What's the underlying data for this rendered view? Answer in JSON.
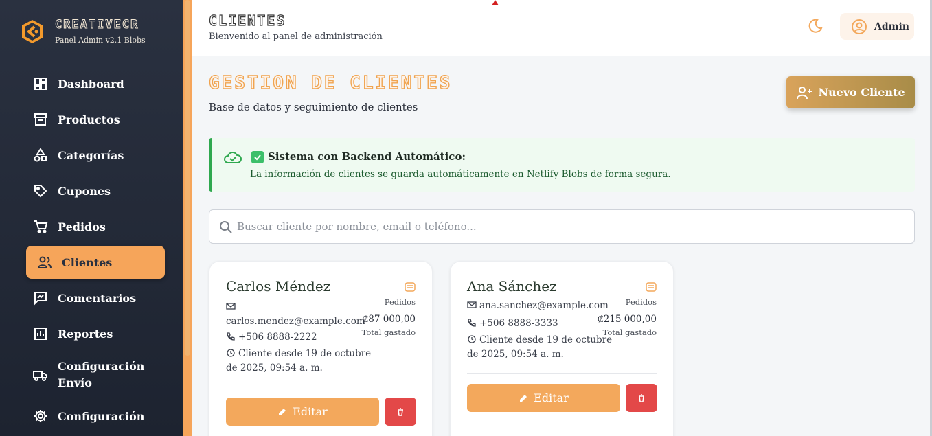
{
  "brand": {
    "name": "CREATIVECR",
    "subtitle": "Panel Admin v2.1 Blobs"
  },
  "sidebar": {
    "items": [
      {
        "label": "Dashboard",
        "icon": "dashboard-icon"
      },
      {
        "label": "Productos",
        "icon": "archive-icon"
      },
      {
        "label": "Categorías",
        "icon": "shapes-icon"
      },
      {
        "label": "Cupones",
        "icon": "tag-icon"
      },
      {
        "label": "Pedidos",
        "icon": "cart-icon"
      },
      {
        "label": "Clientes",
        "icon": "users-icon",
        "active": true
      },
      {
        "label": "Comentarios",
        "icon": "comment-icon"
      },
      {
        "label": "Reportes",
        "icon": "chart-icon"
      },
      {
        "label": "Configuración Envío",
        "icon": "truck-icon"
      },
      {
        "label": "Configuración",
        "icon": "gear-icon"
      }
    ]
  },
  "header": {
    "title": "CLIENTES",
    "subtitle": "Bienvenido al panel de administración",
    "user_label": "Admin"
  },
  "main": {
    "title": "GESTION DE CLIENTES",
    "subtitle": "Base de datos y seguimiento de clientes",
    "new_button": "Nuevo Cliente",
    "alert": {
      "title": "Sistema con Backend Automático:",
      "text": "La información de clientes se guarda automáticamente en Netlify Blobs de forma segura."
    },
    "search": {
      "placeholder": "Buscar cliente por nombre, email o teléfono..."
    },
    "orders_label": "Pedidos",
    "spent_label": "Total gastado",
    "edit_label": "Editar",
    "clients": [
      {
        "name": "Carlos Méndez",
        "email": "carlos.mendez@example.com",
        "phone": "+506 8888-2222",
        "since": "Cliente desde 19 de octubre de 2025, 09:54 a. m.",
        "since_line1": "Cliente desde 19 de octubre",
        "since_line2": "de 2025, 09:54 a. m.",
        "total": "₡87 000,00"
      },
      {
        "name": "Ana Sánchez",
        "email": "ana.sanchez@example.com",
        "phone": "+506 8888-3333",
        "since": "Cliente desde 19 de octubre de 2025, 09:54 a. m.",
        "since_line1": "Cliente desde 19 de octubre",
        "since_line2": "de 2025, 09:54 a. m.",
        "total": "₡215 000,00"
      }
    ]
  },
  "colors": {
    "accent": "#f6a55a",
    "sidebar": "#2a3140",
    "success": "#2fa84f",
    "danger": "#e34848"
  }
}
